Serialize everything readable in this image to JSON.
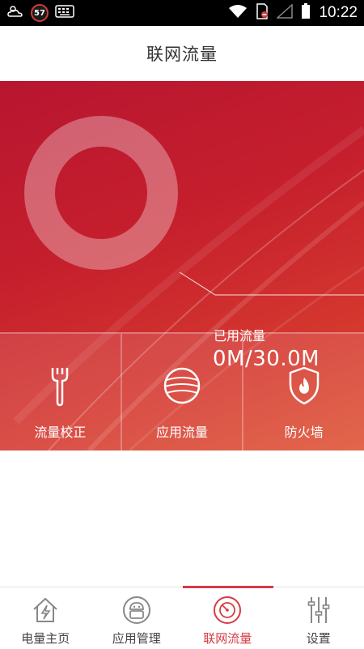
{
  "status": {
    "time": "10:22",
    "badge": "57"
  },
  "header": {
    "title": "联网流量"
  },
  "usage": {
    "label": "已用流量",
    "value": "0M/30.0M",
    "used_fraction": 0
  },
  "tools": [
    {
      "label": "流量校正",
      "icon": "wrench-icon"
    },
    {
      "label": "应用流量",
      "icon": "globe-icon"
    },
    {
      "label": "防火墙",
      "icon": "shield-fire-icon"
    }
  ],
  "nav": [
    {
      "label": "电量主页",
      "icon": "house-bolt-icon"
    },
    {
      "label": "应用管理",
      "icon": "android-icon"
    },
    {
      "label": "联网流量",
      "icon": "traffic-gauge-icon",
      "active": true
    },
    {
      "label": "设置",
      "icon": "sliders-icon"
    }
  ],
  "colors": {
    "accent": "#d63a44",
    "hero": "#c51f2d"
  }
}
